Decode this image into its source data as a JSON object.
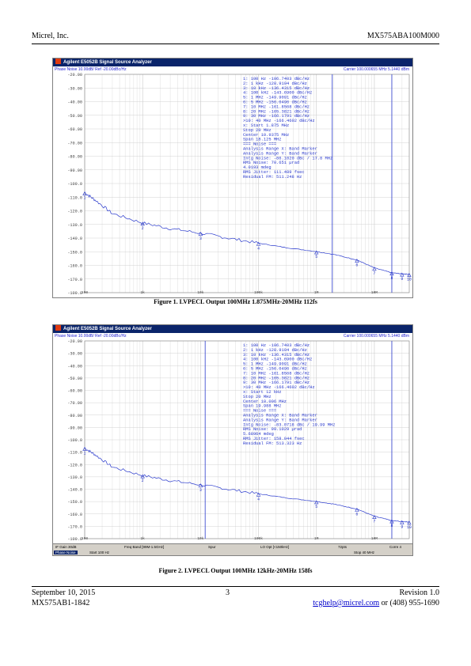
{
  "header": {
    "left": "Micrel, Inc.",
    "right": "MX575ABA100M000"
  },
  "figures": [
    {
      "window_title": "Agilent E5052B Signal Source Analyzer",
      "meas_line": "Phase Noise 10.00dB/ Ref -20.00dBc/Hz",
      "carrier": "Carrier 100.000655 MHz  5.1440 dBm",
      "y_ticks": [
        "-20.00",
        "-30.00",
        "-40.00",
        "-50.00",
        "-60.00",
        "-70.00",
        "-80.00",
        "-90.00",
        "-100.0",
        "-110.0",
        "-120.0",
        "-130.0",
        "-140.0",
        "-150.0",
        "-160.0",
        "-170.0",
        "-100.0"
      ],
      "x_ticks": [
        "100",
        "1k",
        "10k",
        "100k",
        "1M",
        "10M"
      ],
      "markers_table": [
        "1:  100 Hz    -106.7403  dBc/Hz",
        "2:  1 kHz     -128.9194  dBc/Hz",
        "3:  10 kHz    -136.4315  dBc/Hz",
        "4:  100 kHz   -143.6900  dBc/Hz",
        "5:  1 MHz     -149.9091  dBc/Hz",
        "6:  5 MHz     -156.0496  dBc/Hz",
        "7:  10 MHz    -161.8568  dBc/Hz",
        "8:  20 MHz    -165.3821  dBc/Hz",
        "9:  30 MHz    -166.1791  dBc/Hz",
        ">10:  40 MHz  -166.4602  dBc/Hz"
      ],
      "integ_table": [
        "x: Start 1.875 MHz",
        "     Stop 20 MHz",
        "   Center 10.9375 MHz",
        "     Span 18.125 MHz",
        "=== Noise ===",
        "Analysis Range X: Band Marker",
        "Analysis Range Y: Band Marker",
        "Intg Noise: -86.1020 dBc / 17.8 MHz",
        "RMS Noise: 70.651 µrad",
        "           4.0193 mdeg",
        "RMS Jitter: 111.489 fsec",
        "Residual FM: 511.248 Hz"
      ],
      "curve_points": [
        [
          100,
          -106.7
        ],
        [
          150,
          -112
        ],
        [
          300,
          -122
        ],
        [
          1000,
          -128.9
        ],
        [
          3000,
          -133
        ],
        [
          10000,
          -136.4
        ],
        [
          30000,
          -140
        ],
        [
          100000,
          -143.7
        ],
        [
          300000,
          -147
        ],
        [
          1000000,
          -149.9
        ],
        [
          2000000,
          -152
        ],
        [
          5000000,
          -156
        ],
        [
          10000000,
          -161.9
        ],
        [
          20000000,
          -165.4
        ],
        [
          30000000,
          -166.2
        ],
        [
          40000000,
          -166.5
        ]
      ],
      "band": [
        1875000,
        20000000
      ],
      "caption": "Figure 1. LVPECL Output 100MHz 1.875MHz-20MHz 112fs",
      "status": null
    },
    {
      "window_title": "Agilent E5052B Signal Source Analyzer",
      "meas_line": "Phase Noise 10.00dB/ Ref -20.00dBc/Hz",
      "carrier": "Carrier 100.000655 MHz  5.1440 dBm",
      "y_ticks": [
        "-20.00",
        "-30.00",
        "-40.00",
        "-50.00",
        "-60.00",
        "-70.00",
        "-80.00",
        "-90.00",
        "-100.0",
        "-110.0",
        "-120.0",
        "-130.0",
        "-140.0",
        "-150.0",
        "-160.0",
        "-170.0",
        "-100.0"
      ],
      "x_ticks": [
        "100",
        "1k",
        "10k",
        "100k",
        "1M",
        "10M"
      ],
      "markers_table": [
        "1:  100 Hz    -106.7403  dBc/Hz",
        "2:  1 kHz     -128.9194  dBc/Hz",
        "3:  10 kHz    -136.4315  dBc/Hz",
        "4:  100 kHz   -143.6900  dBc/Hz",
        "5:  1 MHz     -149.9091  dBc/Hz",
        "6:  5 MHz     -156.0496  dBc/Hz",
        "7:  10 MHz    -161.8568  dBc/Hz",
        "8:  20 MHz    -165.3821  dBc/Hz",
        "9:  30 MHz    -166.1791  dBc/Hz",
        ">10:  40 MHz  -166.4602  dBc/Hz"
      ],
      "integ_table": [
        "x: Start 12 kHz",
        "     Stop 20 MHz",
        "   Center 10.006 MHz",
        "     Span 19.988 MHz",
        "=== Noise ===",
        "Analysis Range X: Band Marker",
        "Analysis Range Y: Band Marker",
        "Intg Noise: -83.0718 dBc / 19.99 MHz",
        "RMS Noise: 99.1029 µrad",
        "           5.68964 mdeg",
        "RMS Jitter: 158.044 fsec",
        "Residual FM: 513.323 Hz"
      ],
      "curve_points": [
        [
          100,
          -106.7
        ],
        [
          150,
          -112
        ],
        [
          300,
          -122
        ],
        [
          1000,
          -128.9
        ],
        [
          3000,
          -133
        ],
        [
          10000,
          -136.4
        ],
        [
          30000,
          -140
        ],
        [
          100000,
          -143.7
        ],
        [
          300000,
          -147
        ],
        [
          1000000,
          -149.9
        ],
        [
          2000000,
          -152
        ],
        [
          5000000,
          -156
        ],
        [
          10000000,
          -161.9
        ],
        [
          20000000,
          -165.4
        ],
        [
          30000000,
          -166.2
        ],
        [
          40000000,
          -166.5
        ]
      ],
      "band": [
        12000,
        20000000
      ],
      "caption": "Figure 2. LVPECL Output 100MHz 12kHz-20MHz 158fs",
      "status": {
        "row1": [
          "IF Gain 30dB",
          "Freq Band [99M-1.5GHz]",
          "Spur",
          "LO Opt [<150kHz]",
          "72pts",
          "Corre 4"
        ],
        "row2": [
          "Phase Noise",
          "Start 100 Hz",
          "Stop 40 MHz"
        ]
      }
    }
  ],
  "footer": {
    "date": "September 10, 2015",
    "page": "3",
    "revision": "Revision 1.0",
    "docnum": "MX575AB1-1842",
    "email": "tcghelp@micrel.com",
    "phone": " or (408) 955-1690"
  },
  "colors": {
    "trace": "#2a3acd",
    "grid": "#c8c8c8",
    "titlebar": "#0a246a"
  }
}
